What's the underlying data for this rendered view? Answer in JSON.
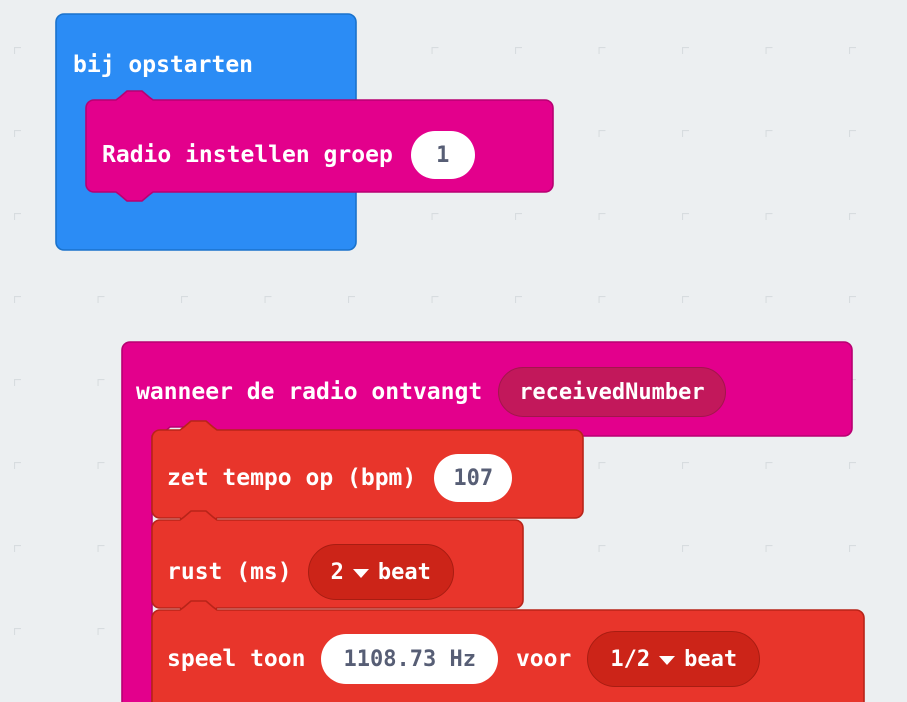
{
  "app": {
    "name": "MakeCode block editor workspace",
    "language": "nl",
    "background_color": "#eceff1",
    "grid_mark_color": "#d7dcdf"
  },
  "colors": {
    "event_blue": "#2b8cf5",
    "event_blue_border": "#1a72cc",
    "radio_magenta": "#e3008c",
    "radio_magenta_border": "#b80072",
    "radio_field_shade": "#c2185b",
    "music_red": "#e8352b",
    "music_red_border": "#b82419",
    "music_field_shade": "#cc2418",
    "field_white": "#ffffff",
    "field_text": "#575e75",
    "label_text": "#ffffff"
  },
  "stacks": [
    {
      "id": "on-start-stack",
      "hat_block": {
        "name": "on-start-block",
        "label": "bij opstarten",
        "category": "basic",
        "color": "#2b8cf5"
      },
      "children": [
        {
          "name": "radio-set-group-block",
          "label": "Radio instellen groep",
          "category": "radio",
          "color": "#e3008c",
          "fields": [
            {
              "name": "radio-group-number-field",
              "kind": "number",
              "value": "1",
              "style": "white"
            }
          ]
        }
      ]
    },
    {
      "id": "on-radio-received-stack",
      "hat_block": {
        "name": "radio-on-received-number-block",
        "label": "wanneer de radio ontvangt",
        "category": "radio",
        "color": "#e3008c",
        "fields": [
          {
            "name": "received-number-variable-field",
            "kind": "variable",
            "value": "receivedNumber",
            "style": "shaded"
          }
        ]
      },
      "children": [
        {
          "name": "music-set-tempo-block",
          "label": "zet tempo op (bpm)",
          "category": "music",
          "color": "#e8352b",
          "fields": [
            {
              "name": "tempo-bpm-field",
              "kind": "number",
              "value": "107",
              "style": "white"
            }
          ]
        },
        {
          "name": "music-rest-block",
          "label": "rust (ms)",
          "category": "music",
          "color": "#e8352b",
          "fields": [
            {
              "name": "rest-beat-dropdown",
              "kind": "dropdown",
              "value": "2",
              "suffix": "beat",
              "style": "shaded"
            }
          ]
        },
        {
          "name": "music-play-tone-block",
          "label": "speel toon",
          "label2": "voor",
          "category": "music",
          "color": "#e8352b",
          "fields": [
            {
              "name": "tone-frequency-field",
              "kind": "note",
              "value": "1108.73 Hz",
              "style": "white"
            },
            {
              "name": "tone-duration-dropdown",
              "kind": "dropdown",
              "value": "1/2",
              "suffix": "beat",
              "style": "shaded"
            }
          ]
        }
      ]
    }
  ]
}
